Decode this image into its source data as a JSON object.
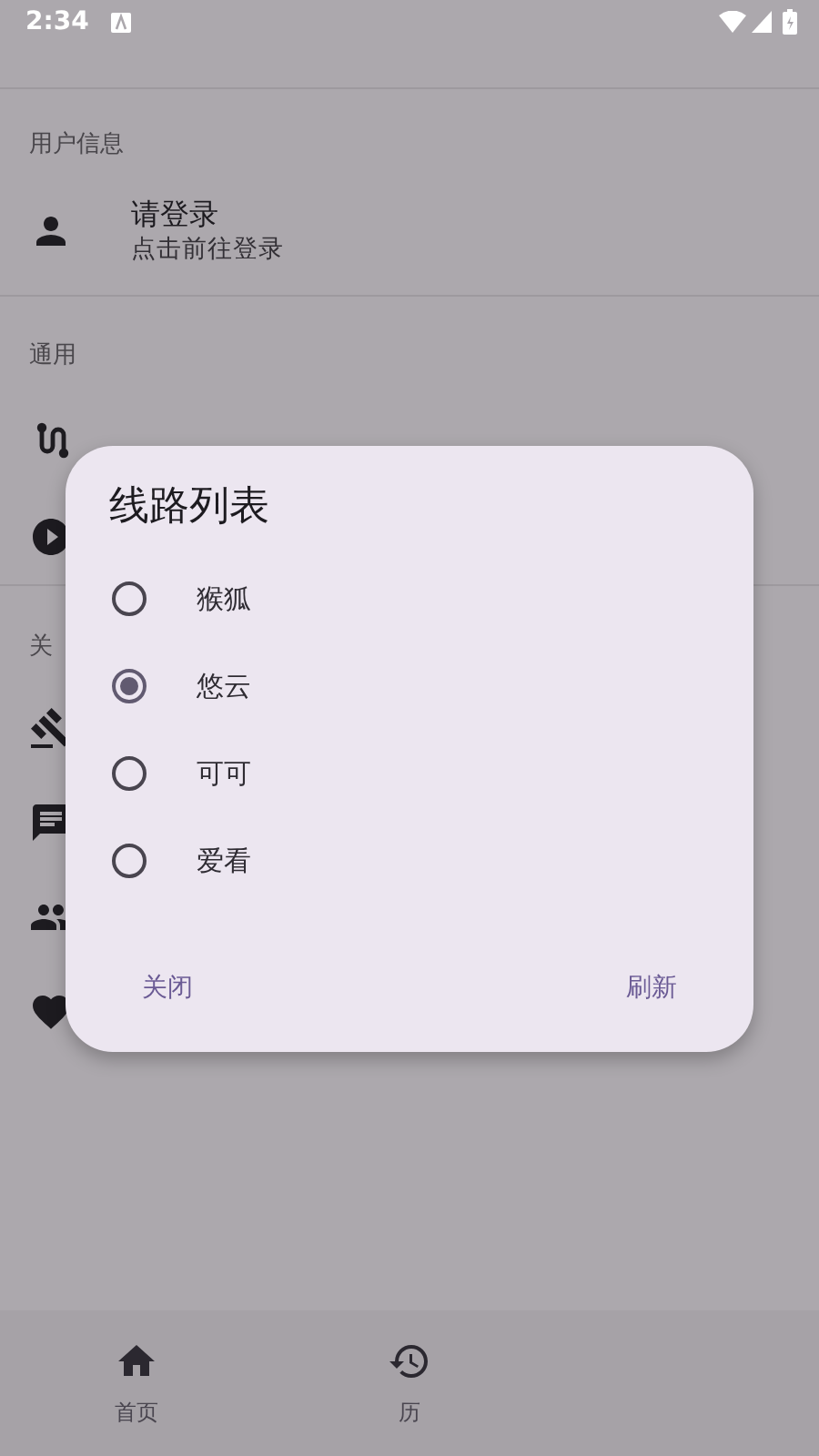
{
  "status_bar": {
    "time": "2:34"
  },
  "sections": [
    {
      "header": "用户信息",
      "items": [
        {
          "kind": "account",
          "title": "请登录",
          "subtitle": "点击前往登录"
        }
      ]
    },
    {
      "header": "通用",
      "items": [
        {
          "kind": "route"
        },
        {
          "kind": "play"
        }
      ]
    },
    {
      "header": "关",
      "items": [
        {
          "kind": "gavel"
        },
        {
          "kind": "chat"
        },
        {
          "kind": "group"
        },
        {
          "kind": "heart"
        }
      ]
    }
  ],
  "dialog": {
    "title": "线路列表",
    "options": [
      {
        "label": "猴狐",
        "selected": false
      },
      {
        "label": "悠云",
        "selected": true
      },
      {
        "label": "可可",
        "selected": false
      },
      {
        "label": "爱看",
        "selected": false
      }
    ],
    "buttons": [
      "关闭",
      "刷新"
    ]
  },
  "bottom_nav": [
    {
      "kind": "home",
      "label": "首页"
    },
    {
      "kind": "history",
      "label": "历"
    }
  ]
}
